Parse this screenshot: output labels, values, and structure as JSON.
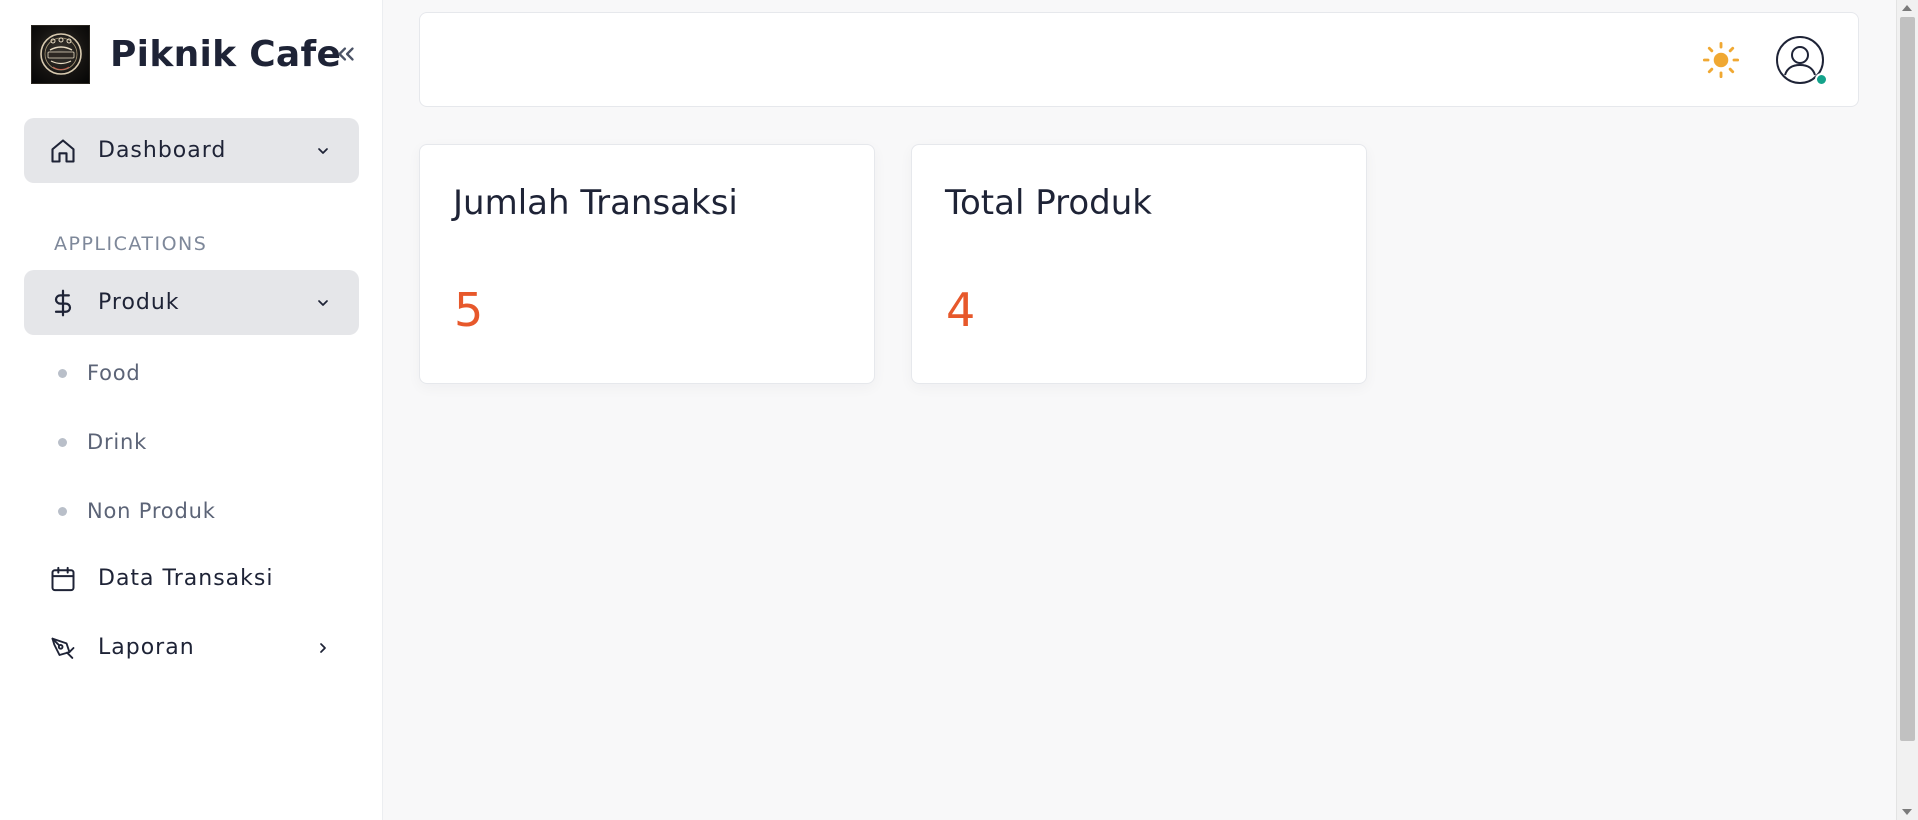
{
  "brand": {
    "name": "Piknik Cafe"
  },
  "sidebar": {
    "section_label": "APPLICATIONS",
    "dashboard": {
      "label": "Dashboard",
      "icon": "home-icon"
    },
    "produk": {
      "label": "Produk",
      "icon": "dollar-icon",
      "children": [
        {
          "label": "Food"
        },
        {
          "label": "Drink"
        },
        {
          "label": "Non Produk"
        }
      ]
    },
    "data_transaksi": {
      "label": "Data Transaksi",
      "icon": "calendar-icon"
    },
    "laporan": {
      "label": "Laporan",
      "icon": "pen-tool-icon"
    }
  },
  "topbar": {
    "theme_icon": "sun-icon",
    "avatar_icon": "user-circle-icon",
    "status_color": "#14a38b"
  },
  "cards": [
    {
      "title": "Jumlah Transaksi",
      "value": "5"
    },
    {
      "title": "Total Produk",
      "value": "4"
    }
  ],
  "colors": {
    "accent_value": "#e7582b",
    "sun": "#f0a832",
    "active_bg": "#e5e6e9",
    "text": "#1e2336"
  }
}
